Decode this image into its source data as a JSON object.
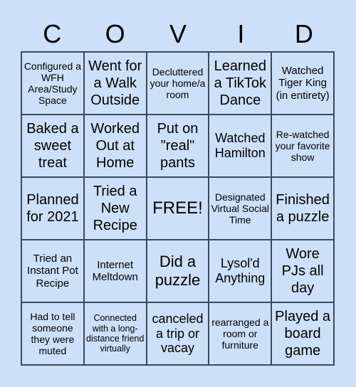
{
  "title_letters": [
    "C",
    "O",
    "V",
    "I",
    "D"
  ],
  "cells": [
    "Configured a WFH Area/Study Space",
    "Went for a Walk Outside",
    "Decluttered your home/a room",
    "Learned a TikTok Dance",
    "Watched Tiger King (in entirety)",
    "Baked a sweet treat",
    "Worked Out at Home",
    "Put on \"real\" pants",
    "Watched Hamilton",
    "Re-watched your favorite show",
    "Planned for 2021",
    "Tried a New Recipe",
    "FREE!",
    "Designated Virtual Social Time",
    "Finished a puzzle",
    "Tried an Instant Pot Recipe",
    "Internet Meltdown",
    "Did a puzzle",
    "Lysol'd Anything",
    "Wore PJs all day",
    "Had to tell someone they were muted",
    "Connected with a long-distance friend virtually",
    "canceled a trip or vacay",
    "rearranged a room or furniture",
    "Played a board game"
  ],
  "colors": {
    "background": "#cce1f7",
    "grid_line": "#3a4a5a",
    "text": "#000000"
  }
}
